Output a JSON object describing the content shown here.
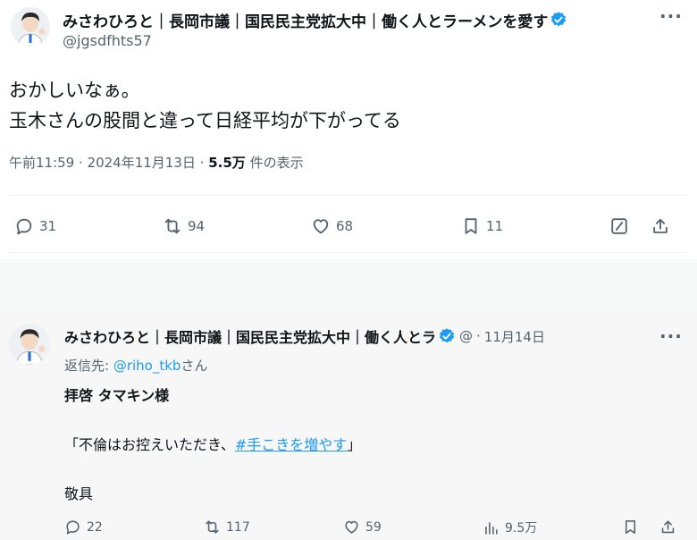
{
  "colors": {
    "accent": "#1d9bf0",
    "muted": "#536471",
    "text": "#0f1419"
  },
  "post1": {
    "display_name": "みさわひろと｜長岡市議｜国民民主党拡大中｜働く人とラーメンを愛す",
    "handle": "@jgsdfhts57",
    "text_line1": "おかしいなぁ。",
    "text_line2": "玉木さんの股間と違って日経平均が下がってる",
    "time": "午前11:59",
    "date": "2024年11月13日",
    "views_count": "5.5万",
    "views_label": "件の表示",
    "actions": {
      "reply": "31",
      "retweet": "94",
      "like": "68",
      "bookmark": "11"
    }
  },
  "post2": {
    "display_name": "みさわひろと｜長岡市議｜国民民主党拡大中｜働く人とラ",
    "handle_short": "@",
    "date": "11月14日",
    "reply_prefix": "返信先: ",
    "reply_handle": "@riho_tkb",
    "reply_suffix": "さん",
    "line1": "拝啓 タマキン様",
    "quote_open": "「不倫はお控えいただき、",
    "hashtag": "#手こきを増やす",
    "quote_close": "」",
    "line3": "敬具",
    "actions": {
      "reply": "22",
      "retweet": "117",
      "like": "59",
      "views": "9.5万"
    }
  }
}
